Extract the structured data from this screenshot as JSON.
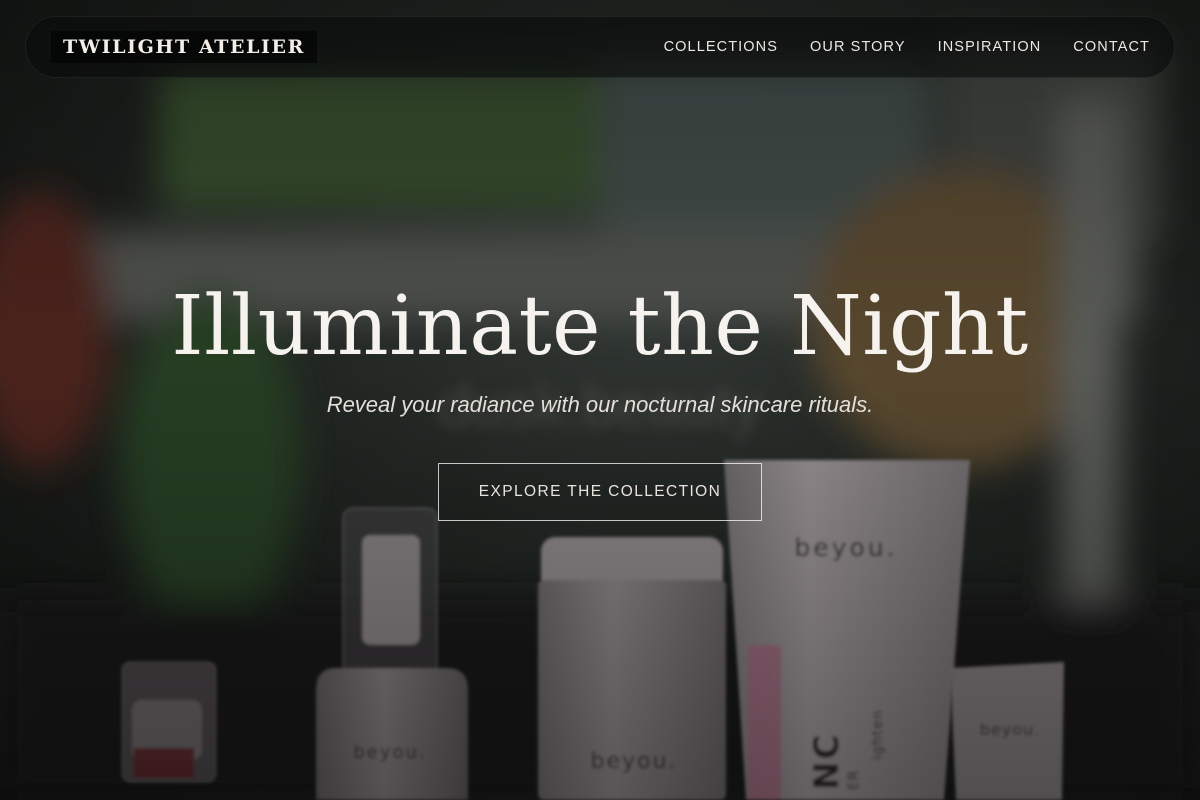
{
  "nav": {
    "brand": "TWILIGHT ATELIER",
    "links": [
      "COLLECTIONS",
      "OUR STORY",
      "INSPIRATION",
      "CONTACT"
    ]
  },
  "hero": {
    "headline": "Illuminate the Night",
    "subheadline": "Reveal your radiance with our nocturnal skincare rituals.",
    "cta_label": "EXPLORE THE COLLECTION",
    "watermark": "dusk.beauty"
  },
  "products": {
    "brand_marks": [
      "beyou.",
      "beyou.",
      "beyou.",
      "beyou."
    ],
    "tube_side_text": "NC",
    "tube_side_small": "ER",
    "tube_side_small_2": "ighten"
  },
  "colors": {
    "headline": "#f6f3ee",
    "nav_bar": "#0a0c0b",
    "cta_border": "#ffffff",
    "tube_accent": "#c7708e"
  }
}
